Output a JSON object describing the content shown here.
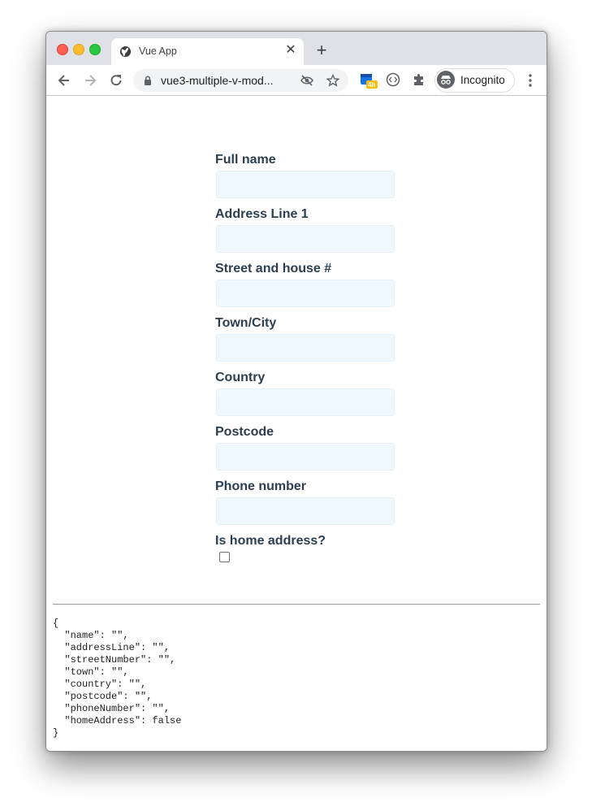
{
  "browser": {
    "tab_title": "Vue App",
    "url": "vue3-multiple-v-mod...",
    "incognito_label": "Incognito",
    "extension_badge": "4h"
  },
  "form": {
    "fields": [
      {
        "label": "Full name",
        "value": ""
      },
      {
        "label": "Address Line 1",
        "value": ""
      },
      {
        "label": "Street and house #",
        "value": ""
      },
      {
        "label": "Town/City",
        "value": ""
      },
      {
        "label": "Country",
        "value": ""
      },
      {
        "label": "Postcode",
        "value": ""
      },
      {
        "label": "Phone number",
        "value": ""
      }
    ],
    "checkbox_label": "Is home address?",
    "checkbox_checked": false
  },
  "output_json": "{\n  \"name\": \"\",\n  \"addressLine\": \"\",\n  \"streetNumber\": \"\",\n  \"town\": \"\",\n  \"country\": \"\",\n  \"postcode\": \"\",\n  \"phoneNumber\": \"\",\n  \"homeAddress\": false\n}"
}
